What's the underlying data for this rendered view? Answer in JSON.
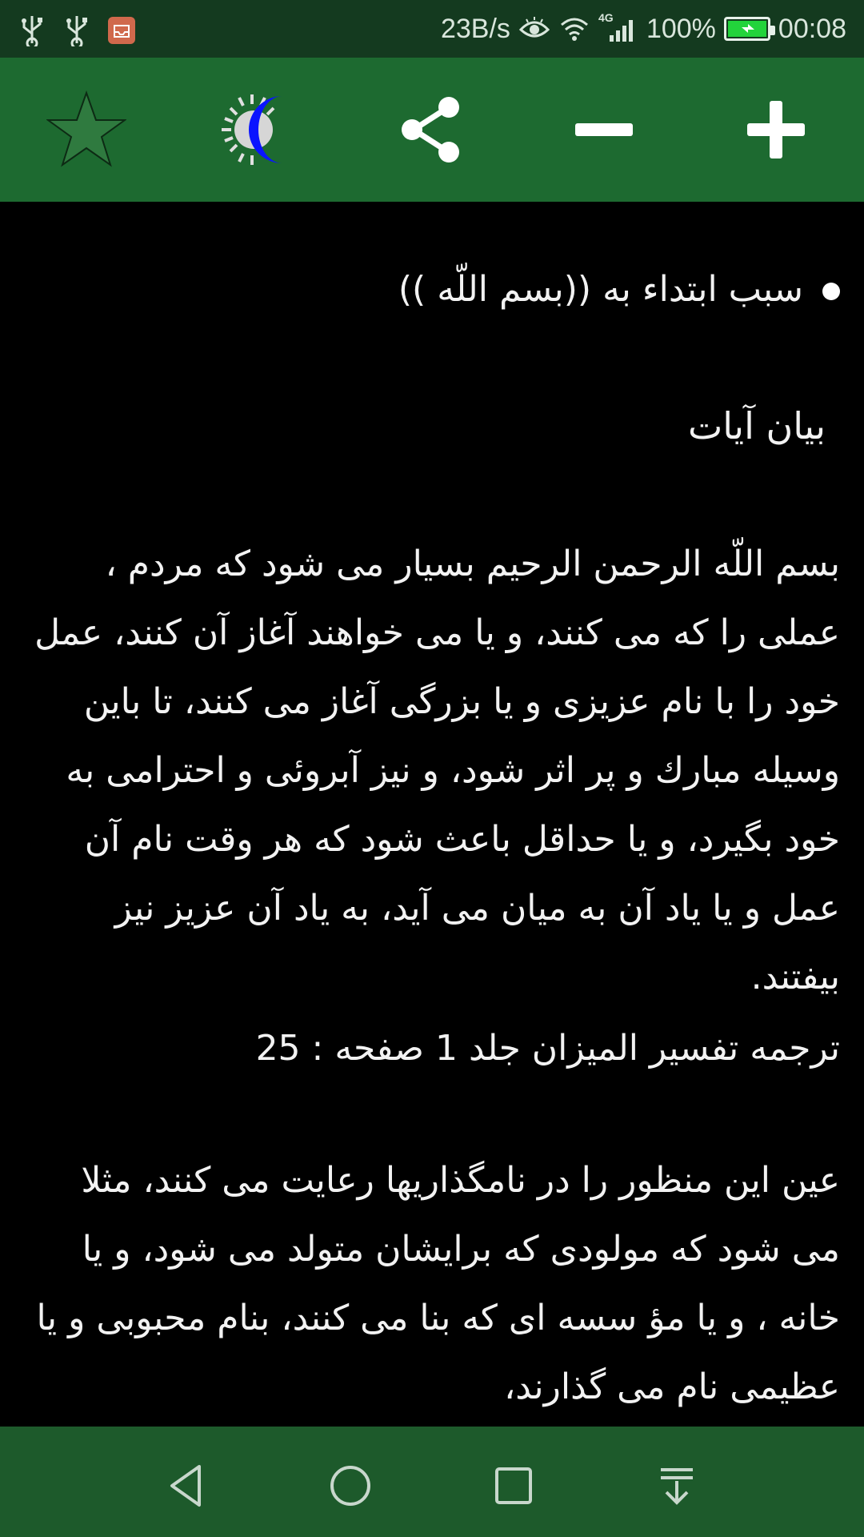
{
  "status_bar": {
    "left_icons": [
      "usb-icon",
      "usb-icon",
      "notification-app-icon"
    ],
    "net_speed": "23B/s",
    "network_label": "4G",
    "battery_percent": "100%",
    "time": "00:08"
  },
  "toolbar": {
    "buttons": [
      "favorite-star-icon",
      "night-mode-icon",
      "share-icon",
      "decrease-font-icon",
      "increase-font-icon"
    ]
  },
  "content": {
    "bullet_title": "سبب ابتداء به ((بسم اللّه ))",
    "heading": "بيان آيات",
    "paragraph1": "بسم اللّه الرحمن الرحيم بسيار مى شود كه مردم ، عملى را كه مى كنند، و يا مى خواهند آغاز آن كنند، عمل خود را با نام عزيزى و يا بزرگى آغاز مى كنند، تا باين وسيله مبارك و پر اثر شود، و نيز آبروئى و احترامى به خود بگيرد، و يا حداقل باعث شود كه هر وقت نام آن عمل و يا ياد آن به ميان مى آيد، به ياد آن عزيز نيز بيفتند.",
    "source": "ترجمه تفسير الميزان جلد 1 صفحه : 25",
    "paragraph2": "عين اين منظور را در نامگذاريها رعايت مى كنند، مثلا مى شود كه مولودى كه برايشان متولد مى شود، و يا خانه ، و يا مؤ سسه اى كه بنا مى كنند، بنام محبوبى و يا عظيمى نام مى گذارند،"
  },
  "navbar": {
    "buttons": [
      "back-icon",
      "home-icon",
      "recents-icon",
      "notification-pull-icon"
    ]
  },
  "colors": {
    "status_bar": "#143a1f",
    "toolbar": "#1d6a30",
    "navbar": "#1d5a2b",
    "background": "#000000",
    "text": "#f2f2f2",
    "moon": "#0000ff"
  }
}
